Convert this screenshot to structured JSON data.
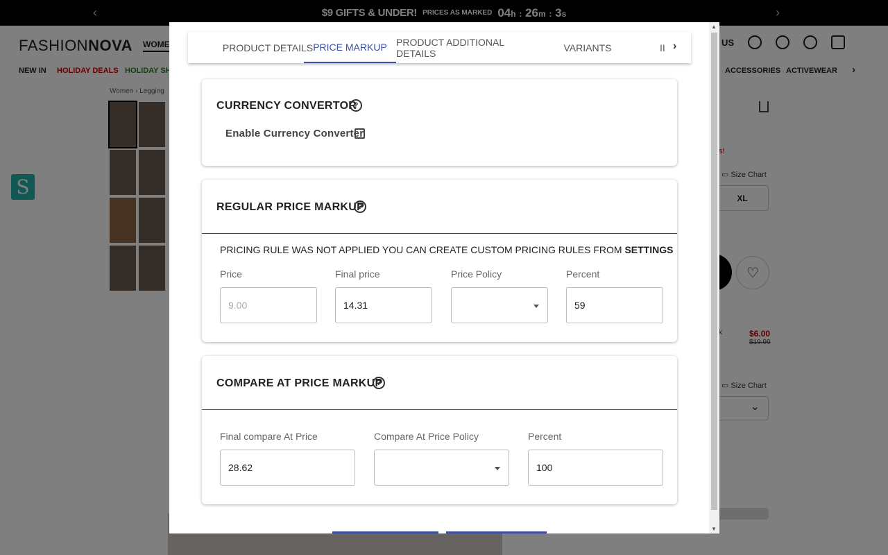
{
  "promo": {
    "main": "$9 GIFTS & UNDER!",
    "note": "PRICES AS MARKED",
    "timer_h": "04",
    "h_unit": "h",
    "timer_m": "26",
    "m_unit": "m",
    "timer_s": "3",
    "s_unit": "s",
    "colon": ":"
  },
  "store": {
    "logo_light": "FASHION",
    "logo_bold": "NOVA",
    "nav_women": "WOMEN",
    "region": "US",
    "categories": [
      "NEW IN",
      "HOLIDAY DEALS",
      "HOLIDAY SHO",
      "ACCESSORIES",
      "ACTIVEWEAR"
    ],
    "breadcrumb": [
      "Women",
      "Legging"
    ],
    "size_chart_label": "Size Chart",
    "size_xl": "XL",
    "price_sale": "$6.00",
    "price_original": "$19.99",
    "promo_snippet": "s!",
    "item_snippet": "k"
  },
  "modal": {
    "tabs": [
      {
        "label": "PRODUCT DETAILS",
        "active": false
      },
      {
        "label": "PRICE MARKUP",
        "active": true
      },
      {
        "label": "PRODUCT ADDITIONAL DETAILS",
        "active": false
      },
      {
        "label": "VARIANTS",
        "active": false
      },
      {
        "label": "II",
        "active": false
      }
    ],
    "currency": {
      "title": "CURRENCY CONVERTOR",
      "enable_label": "Enable Currency Converter",
      "enabled": false
    },
    "regular": {
      "title": "REGULAR PRICE MARKUP",
      "notice_prefix": "PRICING RULE WAS NOT APPLIED YOU CAN CREATE CUSTOM PRICING RULES FROM ",
      "notice_link": "SETTINGS",
      "price_label": "Price",
      "price_value": "9.00",
      "final_label": "Final price",
      "final_value": "14.31",
      "policy_label": "Price Policy",
      "policy_value": "",
      "percent_label": "Percent",
      "percent_value": "59"
    },
    "compare": {
      "title": "COMPARE AT PRICE MARKUP",
      "final_label": "Final compare At Price",
      "final_value": "28.62",
      "policy_label": "Compare At Price Policy",
      "policy_value": "",
      "percent_label": "Percent",
      "percent_value": "100"
    }
  },
  "colors": {
    "accent": "#3a4fa0",
    "sale": "#cc0000",
    "badge": "#21b3a8"
  }
}
